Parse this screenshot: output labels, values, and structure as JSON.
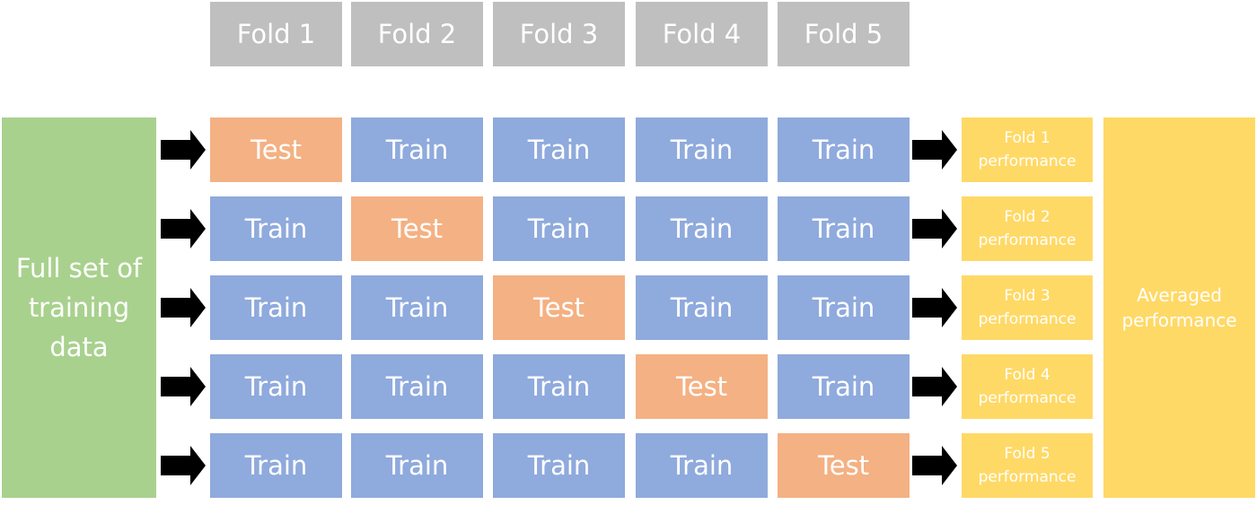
{
  "folds": [
    "Fold 1",
    "Fold 2",
    "Fold 3",
    "Fold 4",
    "Fold 5"
  ],
  "full_set": "Full set of training data",
  "rows": [
    [
      "Test",
      "Train",
      "Train",
      "Train",
      "Train"
    ],
    [
      "Train",
      "Test",
      "Train",
      "Train",
      "Train"
    ],
    [
      "Train",
      "Train",
      "Test",
      "Train",
      "Train"
    ],
    [
      "Train",
      "Train",
      "Train",
      "Test",
      "Train"
    ],
    [
      "Train",
      "Train",
      "Train",
      "Train",
      "Test"
    ]
  ],
  "performance": [
    "Fold 1 performance",
    "Fold 2 performance",
    "Fold 3 performance",
    "Fold 4 performance",
    "Fold 5 performance"
  ],
  "averaged": "Averaged performance",
  "colors": {
    "header": "#bfbfbf",
    "train": "#8faadc",
    "test": "#f4b183",
    "full_set": "#a9d18e",
    "performance": "#ffd966",
    "arrow": "#000000"
  }
}
